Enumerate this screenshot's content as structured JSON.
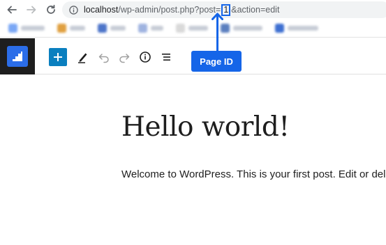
{
  "browser": {
    "url_host": "localhost",
    "url_before_id": "/wp-admin/post.php?post=",
    "url_id": "1",
    "url_after_id": "&action=edit"
  },
  "annotation": {
    "label": "Page ID",
    "color": "#1565e8"
  },
  "editor": {
    "logo_icon": "wordpress-icon",
    "toolbar_icons": [
      "add-block-icon",
      "pencil-icon",
      "undo-icon",
      "redo-icon",
      "info-icon",
      "list-view-icon"
    ],
    "accent_color": "#0a7fbf"
  },
  "post": {
    "title": "Hello world!",
    "body": "Welcome to WordPress. This is your first post. Edit or dele"
  }
}
